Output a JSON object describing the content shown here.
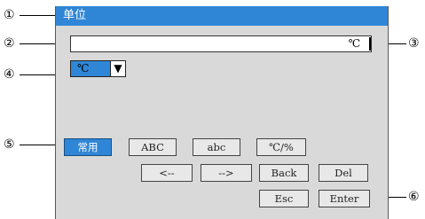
{
  "dialog": {
    "title": "单位",
    "input_value": "℃",
    "unit_select": {
      "selected": "℃",
      "arrow": "▼"
    }
  },
  "keyboard": {
    "mode_buttons": [
      "常用",
      "ABC",
      "abc",
      "℃/%"
    ],
    "nav_buttons": [
      "<--",
      "-->",
      "Back",
      "Del"
    ],
    "action_buttons": [
      "Esc",
      "Enter"
    ]
  },
  "callouts": [
    "①",
    "②",
    "③",
    "④",
    "⑤",
    "⑥"
  ]
}
